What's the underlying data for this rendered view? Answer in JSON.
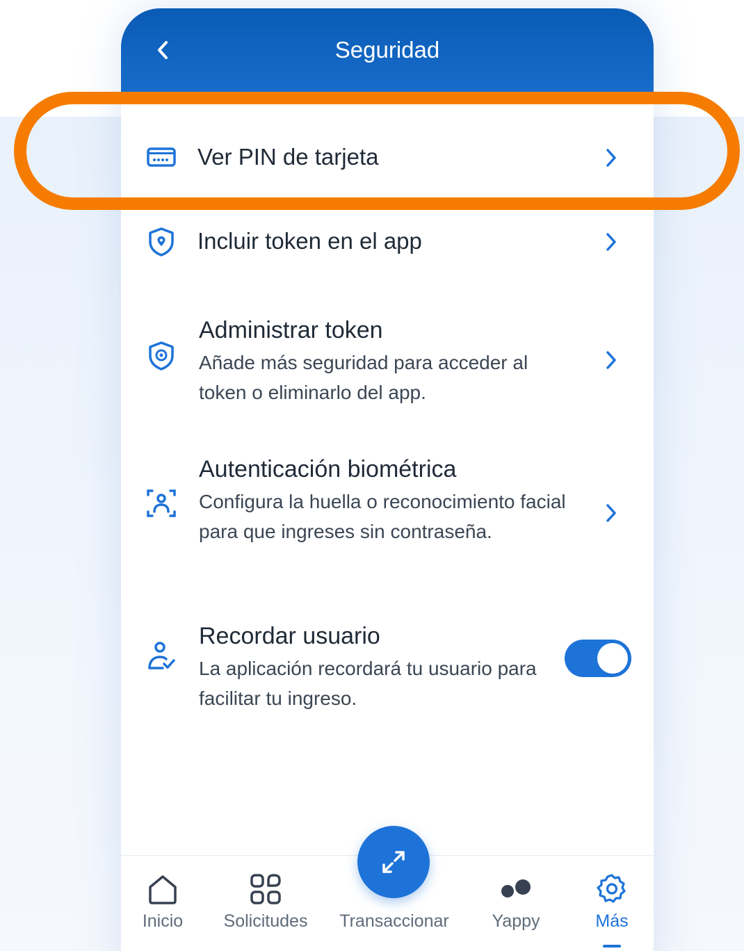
{
  "header": {
    "title": "Seguridad",
    "back_icon": "chevron-left-icon"
  },
  "items": [
    {
      "title": "Ver PIN de tarjeta",
      "icon": "card-pin-icon",
      "chevron": "chevron-right-icon"
    },
    {
      "title": "Incluir token en el app",
      "icon": "shield-location-icon",
      "chevron": "chevron-right-icon"
    },
    {
      "title": "Administrar token",
      "description": "Añade más seguridad para acceder al token o eliminarlo del app.",
      "icon": "shield-gear-icon",
      "chevron": "chevron-right-icon"
    },
    {
      "title": "Autenticación biométrica",
      "description": "Configura la huella o reconocimiento facial para que ingreses sin contraseña.",
      "icon": "face-scan-icon",
      "chevron": "chevron-right-icon"
    },
    {
      "title": "Recordar usuario",
      "description": "La aplicación recordará tu usuario para facilitar tu ingreso.",
      "icon": "user-check-icon",
      "toggle_on": true
    }
  ],
  "bottom_nav": [
    {
      "label": "Inicio",
      "icon": "home-icon"
    },
    {
      "label": "Solicitudes",
      "icon": "grid-icon"
    },
    {
      "label": "Transaccionar",
      "icon": "transfer-arrows-icon"
    },
    {
      "label": "Yappy",
      "icon": "yappy-icon"
    },
    {
      "label": "Más",
      "icon": "gear-icon",
      "active": true
    }
  ],
  "colors": {
    "primary": "#1d73d8",
    "header": "#0a5bb5",
    "highlight": "#f57c00"
  }
}
